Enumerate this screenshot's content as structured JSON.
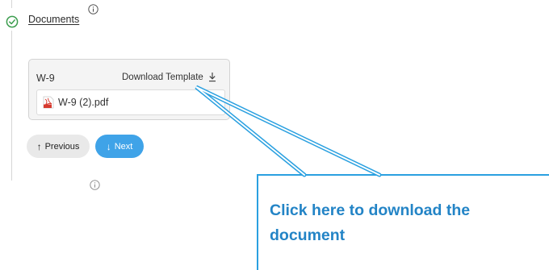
{
  "step": {
    "title": "Documents",
    "status_icon": "check-circle-icon",
    "info_icon": "info-icon"
  },
  "document": {
    "name": "W-9",
    "download_label": "Download Template",
    "download_icon": "download-icon",
    "file_icon": "pdf-file-icon",
    "file_name": "W-9 (2).pdf"
  },
  "navigation": {
    "previous_label": "Previous",
    "previous_arrow": "↑",
    "next_label": "Next",
    "next_arrow": "↓"
  },
  "callout": {
    "text": "Click here to download the document"
  },
  "colors": {
    "accent": "#3fa3e8",
    "callout_text": "#2384c6",
    "check": "#3c9d4e"
  }
}
